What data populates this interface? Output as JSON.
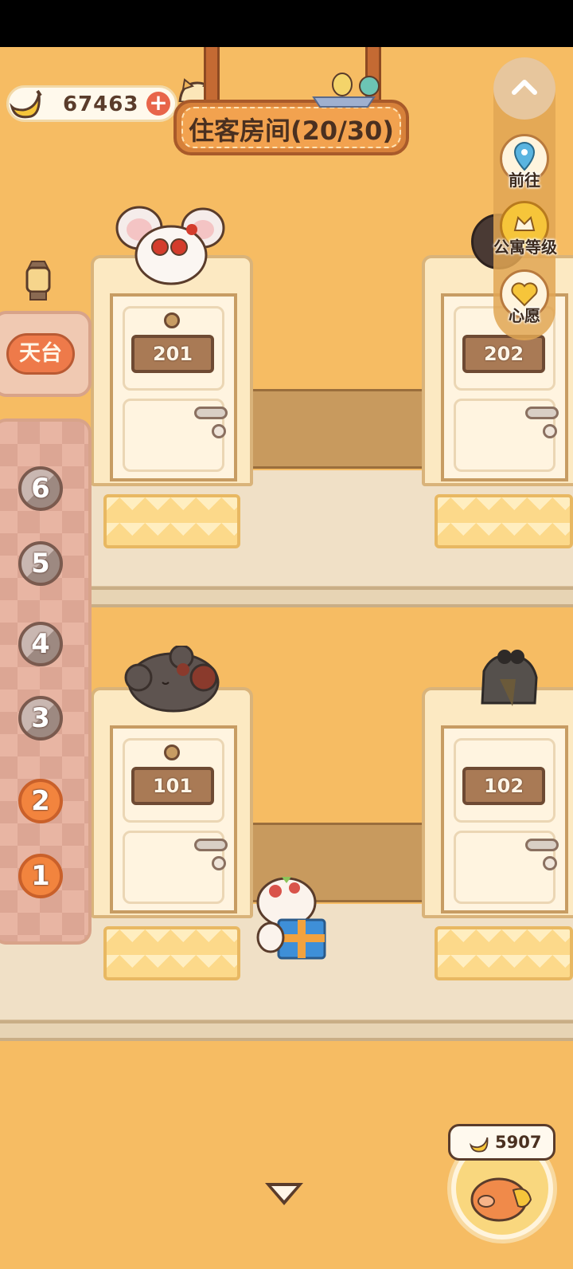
{
  "header": {
    "coins": "67463",
    "title": "住客房间(20/30)"
  },
  "side_menu": {
    "items": [
      {
        "label": "前往",
        "icon": "map-pin-icon"
      },
      {
        "label": "公寓等级",
        "icon": "apartment-level-icon"
      },
      {
        "label": "心愿",
        "icon": "heart-wish-icon"
      }
    ]
  },
  "floors": {
    "rooftop": "天台",
    "buttons": [
      "6",
      "5",
      "4",
      "3",
      "2",
      "1"
    ],
    "active": [
      "2",
      "1"
    ]
  },
  "rooms": {
    "r201": "201",
    "r202": "202",
    "r101": "101",
    "r102": "102"
  },
  "bank": {
    "amount": "5907"
  },
  "colors": {
    "background": "#F6BC63",
    "accent": "#EE7A4A",
    "text": "#4A3020"
  }
}
